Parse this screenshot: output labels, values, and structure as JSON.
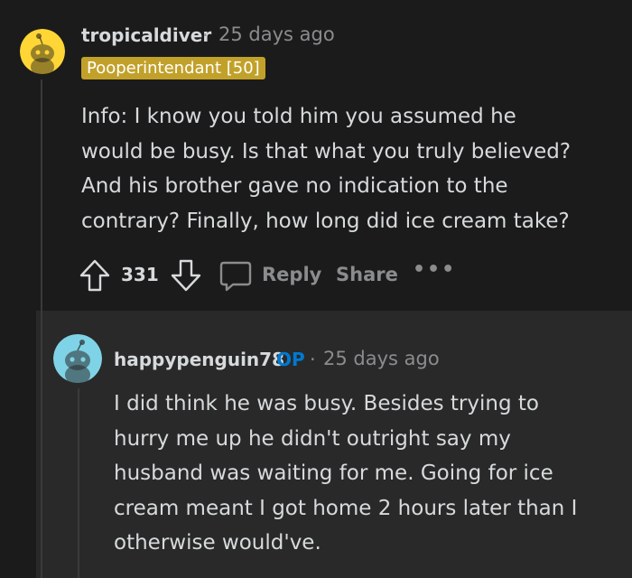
{
  "comment": {
    "username": "tropicaldiver",
    "separator": "·",
    "timestamp": "25 days ago",
    "flair": "Pooperintendant [50]",
    "body_lines": [
      "Info: I know you told him you assumed he",
      "would be busy. Is that what you truly believed?",
      "And his brother gave no indication to the",
      "contrary? Finally, how long did ice cream take?"
    ],
    "actions": {
      "vote_count": "331",
      "reply_label": "Reply",
      "share_label": "Share",
      "more_label": "•••"
    },
    "avatar_color": "#ffd635"
  },
  "reply": {
    "username": "happypenguin78",
    "op_badge": "OP",
    "separator": "·",
    "timestamp": "25 days ago",
    "body_lines": [
      "I did think he was busy. Besides trying to",
      "hurry me up he didn't outright say my",
      "husband was waiting for me. Going for ice",
      "cream meant I got home 2 hours later than I",
      "otherwise would've."
    ],
    "avatar_color": "#7fd3e6"
  },
  "colors": {
    "background": "#1b1b1b",
    "reply_panel": "#292929",
    "flair_bg": "#c2a12a",
    "op_blue": "#0079d3",
    "muted_text": "#8a8c8e"
  }
}
